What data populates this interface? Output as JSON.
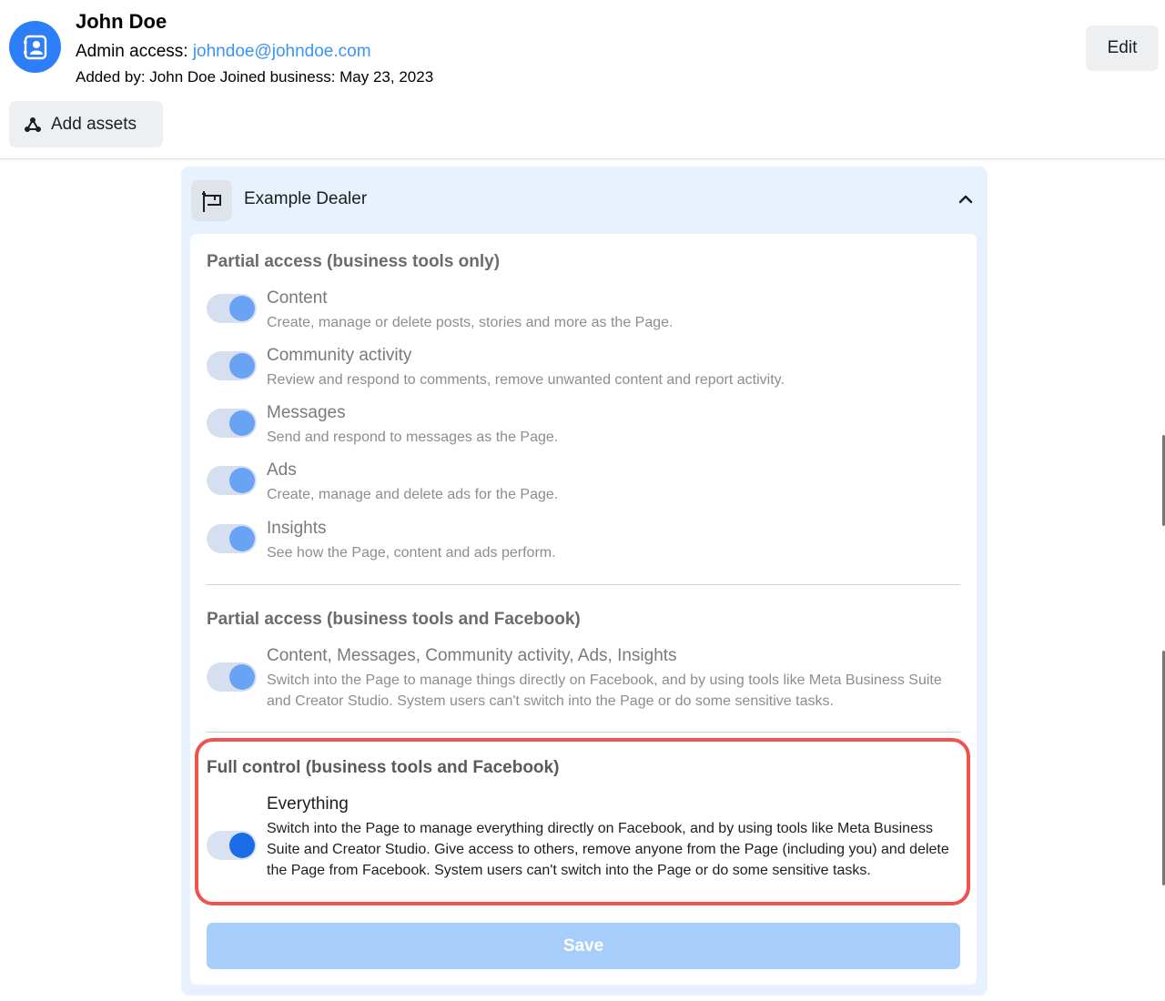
{
  "header": {
    "user_name": "John Doe",
    "admin_prefix": "Admin access: ",
    "admin_email": "johndoe@johndoe.com",
    "added_line": "Added by: John Doe Joined business: May 23, 2023",
    "edit_label": "Edit",
    "add_assets_label": "Add assets"
  },
  "card": {
    "title": "Example Dealer",
    "sections": [
      {
        "title": "Partial access (business tools only)",
        "permissions": [
          {
            "label": "Content",
            "description": "Create, manage or delete posts, stories and more as the Page.",
            "enabled": true
          },
          {
            "label": "Community activity",
            "description": "Review and respond to comments, remove unwanted content and report activity.",
            "enabled": true
          },
          {
            "label": "Messages",
            "description": "Send and respond to messages as the Page.",
            "enabled": true
          },
          {
            "label": "Ads",
            "description": "Create, manage and delete ads for the Page.",
            "enabled": true
          },
          {
            "label": "Insights",
            "description": "See how the Page, content and ads perform.",
            "enabled": true
          }
        ]
      },
      {
        "title": "Partial access (business tools and Facebook)",
        "permissions": [
          {
            "label": "Content, Messages, Community activity, Ads, Insights",
            "description": "Switch into the Page to manage things directly on Facebook, and by using tools like Meta Business Suite and Creator Studio. System users can't switch into the Page or do some sensitive tasks.",
            "enabled": true
          }
        ]
      },
      {
        "title": "Full control (business tools and Facebook)",
        "permissions": [
          {
            "label": "Everything",
            "description": "Switch into the Page to manage everything directly on Facebook, and by using tools like Meta Business Suite and Creator Studio. Give access to others, remove anyone from the Page (including you) and delete the Page from Facebook. System users can't switch into the Page or do some sensitive tasks.",
            "enabled": true
          }
        ]
      }
    ],
    "save_label": "Save"
  },
  "colors": {
    "accent": "#1b6ce6",
    "link": "#3b93f4",
    "highlight": "#ee534e",
    "card_bg": "#e7f2fe"
  }
}
